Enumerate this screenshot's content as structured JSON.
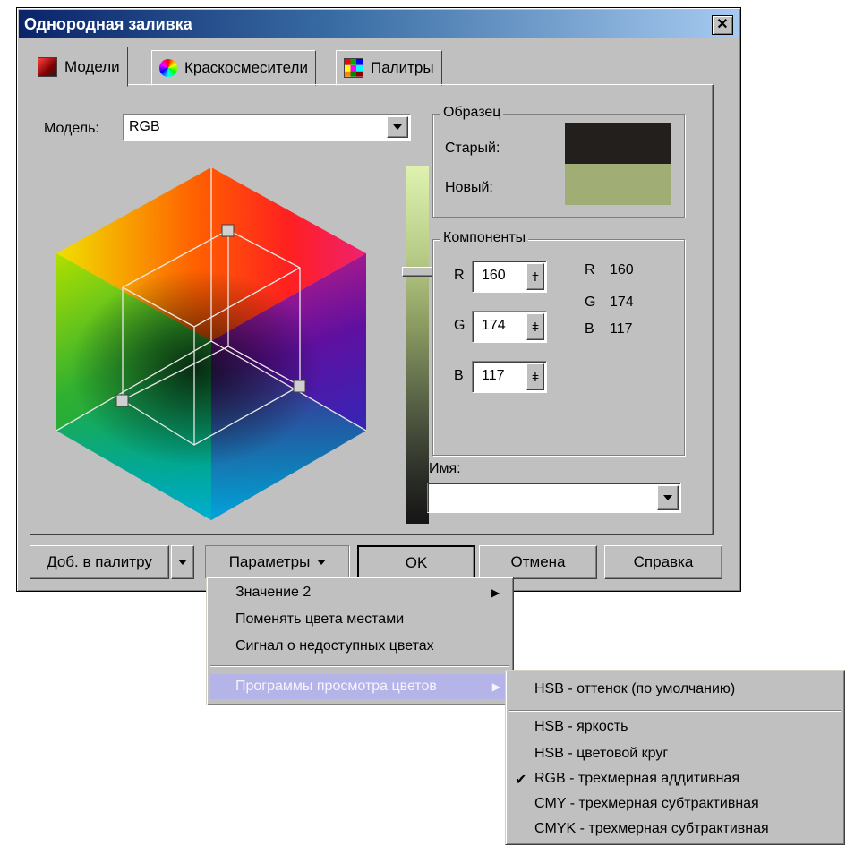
{
  "dialog": {
    "title": "Однородная заливка",
    "close_label": "✕"
  },
  "tabs": [
    {
      "label": "Модели",
      "icon": "models-icon",
      "active": true
    },
    {
      "label": "Краскосмесители",
      "icon": "color-wheel-icon",
      "active": false
    },
    {
      "label": "Палитры",
      "icon": "palette-grid-icon",
      "active": false
    }
  ],
  "model": {
    "label": "Модель:",
    "value": "RGB"
  },
  "sample": {
    "group_title": "Образец",
    "old_label": "Старый:",
    "new_label": "Новый:",
    "old_color": "#231f1c",
    "new_color": "#a0ae75"
  },
  "components": {
    "group_title": "Компоненты",
    "fields": [
      {
        "label": "R",
        "value": "160"
      },
      {
        "label": "G",
        "value": "174"
      },
      {
        "label": "B",
        "value": "117"
      }
    ],
    "readout": [
      {
        "label": "R",
        "value": "160"
      },
      {
        "label": "G",
        "value": "174"
      },
      {
        "label": "B",
        "value": "117"
      }
    ]
  },
  "name_field": {
    "label": "Имя:",
    "value": ""
  },
  "buttons": {
    "add_to_palette": "Доб. в палитру",
    "options": "Параметры",
    "ok": "OK",
    "cancel": "Отмена",
    "help": "Справка"
  },
  "options_menu": {
    "items": [
      {
        "label": "Значение 2",
        "has_submenu": true
      },
      {
        "label": "Поменять цвета местами"
      },
      {
        "label": "Сигнал о недоступных цветах"
      },
      {
        "label": "Программы просмотра цветов",
        "has_submenu": true,
        "highlighted": true
      }
    ]
  },
  "viewers_submenu": {
    "items": [
      {
        "label": "HSB - оттенок (по умолчанию)"
      },
      {
        "label": "HSB - яркость"
      },
      {
        "label": "HSB - цветовой круг"
      },
      {
        "label": "RGB - трехмерная аддитивная",
        "checked": true
      },
      {
        "label": "CMY - трехмерная субтрактивная"
      },
      {
        "label": "CMYK - трехмерная субтрактивная"
      }
    ]
  },
  "colors": {
    "face": "#c0c0c0",
    "highlight": "#3a6ea5",
    "title_start": "#0a246a"
  }
}
